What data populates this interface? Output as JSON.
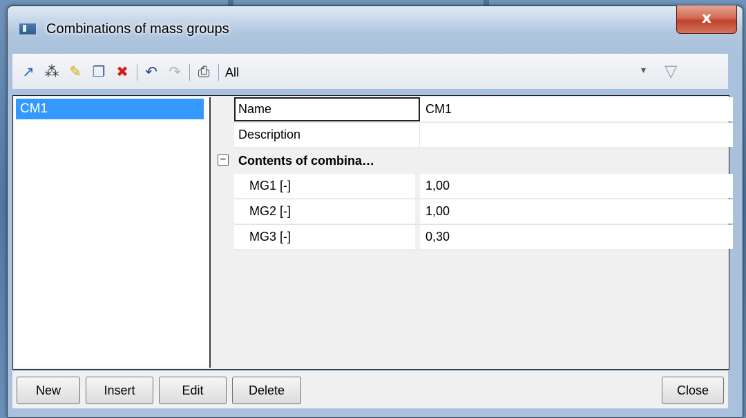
{
  "window": {
    "title": "Combinations of mass groups",
    "close_glyph": "x"
  },
  "toolbar": {
    "icons": [
      "new-record-icon",
      "insert-columns-icon",
      "edit-pencil-icon",
      "copy-icon",
      "delete-icon",
      "undo-icon",
      "redo-icon",
      "print-icon"
    ],
    "filter_value": "All",
    "dropdown_glyph": "▾",
    "filter_glyph": "▽"
  },
  "list": {
    "items": [
      "CM1"
    ]
  },
  "properties": {
    "name_label": "Name",
    "name_value": "CM1",
    "description_label": "Description",
    "description_value": "",
    "group_toggle": "−",
    "group_label": "Contents of combina…",
    "rows": [
      {
        "key": "MG1 [-]",
        "value": "1,00"
      },
      {
        "key": "MG2 [-]",
        "value": "1,00"
      },
      {
        "key": "MG3 [-]",
        "value": "0,30"
      }
    ]
  },
  "buttons": {
    "new": "New",
    "insert": "Insert",
    "edit": "Edit",
    "delete": "Delete",
    "close": "Close"
  }
}
